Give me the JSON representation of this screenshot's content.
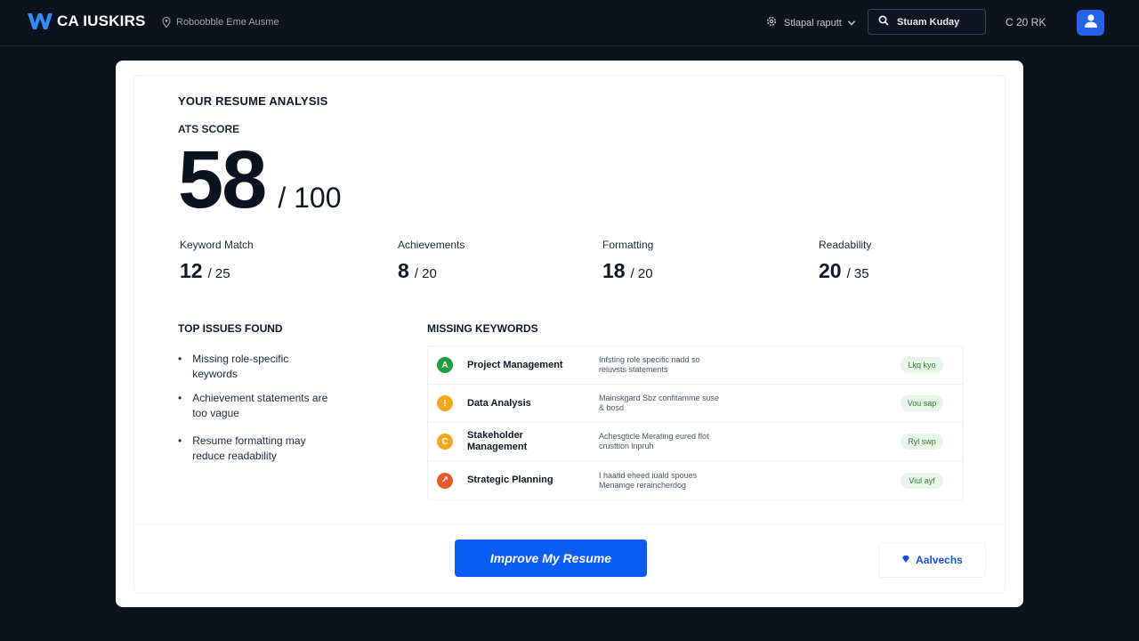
{
  "header": {
    "logo_text": "CA IUSKIRS",
    "location": "Roboobble Eme Ausme",
    "workspace": "Stlapal raputt",
    "search_placeholder": "Stuam Kuday",
    "credits": "C 20 RK"
  },
  "analysis": {
    "heading": "YOUR RESUME ANALYSIS",
    "ats_label": "ATS SCORE",
    "score": "58",
    "score_max": "/ 100"
  },
  "metrics": [
    {
      "label": "Keyword Match",
      "score": "12",
      "max": "/ 25"
    },
    {
      "label": "Achievements",
      "score": "8",
      "max": "/ 20"
    },
    {
      "label": "Formatting",
      "score": "18",
      "max": "/ 20"
    },
    {
      "label": "Readability",
      "score": "20",
      "max": "/ 35"
    }
  ],
  "issues": {
    "title": "TOP ISSUES FOUND",
    "items": [
      "Missing role-specific keywords",
      "Achievement statements are too vague",
      "Resume formatting may reduce readability"
    ]
  },
  "keywords": {
    "title": "MISSING KEYWORDS",
    "items": [
      {
        "name": "Project Management",
        "desc": "Infsting role specific nadd so reluvsts statements",
        "tag": "Lkq kyo",
        "icon": "A",
        "color": "#1e9e3e"
      },
      {
        "name": "Data Analysis",
        "desc": "Mainskgard Sbz confitamme suse & bosd",
        "tag": "Vou sap",
        "icon": "!",
        "color": "#f2a81d"
      },
      {
        "name": "Stakeholder Management",
        "desc": "Achesgticle Merating eured flot crusttion lnpruh",
        "tag": "Ryl swp",
        "icon": "C",
        "color": "#f2a81d"
      },
      {
        "name": "Strategic Planning",
        "desc": "I  haatid eheed iuald spoues Menamge reraincherdog",
        "tag": "Viul ayf",
        "icon": "↗",
        "color": "#ea5a2c"
      }
    ]
  },
  "actions": {
    "primary": "Improve My Resume",
    "secondary": "Aalvechs"
  },
  "colors": {
    "background": "#0d121c",
    "accent": "#0b5cf5",
    "tag_bg": "#e8f5e9",
    "tag_text": "#2e7d32"
  }
}
